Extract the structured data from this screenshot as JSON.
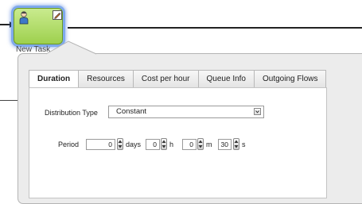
{
  "task": {
    "label": "New Task",
    "icons": {
      "type": "user-icon",
      "edit": "pencil-icon"
    },
    "colors": {
      "fill": "#b5e06a",
      "selection_glow": "#7fa9ec"
    }
  },
  "tabs": [
    {
      "label": "Duration",
      "active": true
    },
    {
      "label": "Resources",
      "active": false
    },
    {
      "label": "Cost per hour",
      "active": false
    },
    {
      "label": "Queue Info",
      "active": false
    },
    {
      "label": "Outgoing Flows",
      "active": false
    }
  ],
  "duration": {
    "distribution_type": {
      "label": "Distribution Type",
      "value": "Constant"
    },
    "period": {
      "label": "Period",
      "days": {
        "value": "0",
        "unit": "days"
      },
      "hours": {
        "value": "0",
        "unit": "h"
      },
      "minutes": {
        "value": "0",
        "unit": "m"
      },
      "seconds": {
        "value": "30",
        "unit": "s"
      }
    }
  }
}
